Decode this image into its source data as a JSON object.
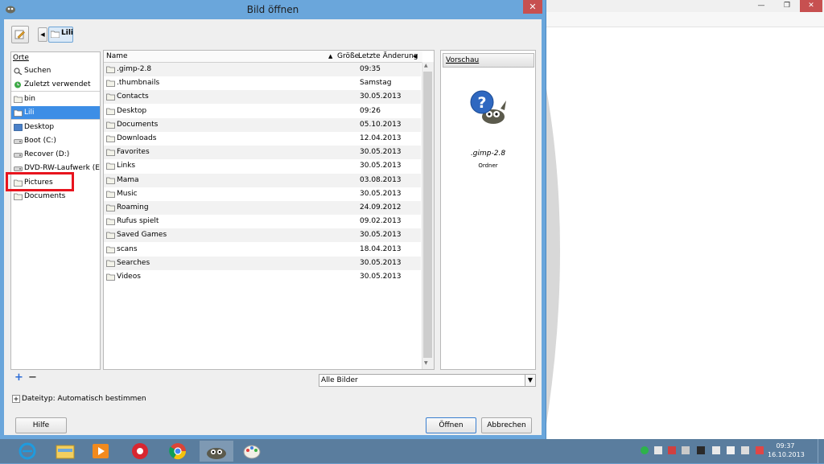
{
  "dialog": {
    "title": "Bild öffnen",
    "close_glyph": "✕"
  },
  "pathbar": {
    "current": "Lili"
  },
  "places": {
    "header": "Orte",
    "items": [
      {
        "label": "Suchen",
        "icon": "search-icon"
      },
      {
        "label": "Zuletzt verwendet",
        "icon": "recent-icon"
      },
      {
        "label": "bin",
        "icon": "folder-icon"
      },
      {
        "label": "Lili",
        "icon": "home-folder-icon",
        "selected": true
      },
      {
        "label": "Desktop",
        "icon": "desktop-icon"
      },
      {
        "label": "Boot (C:)",
        "icon": "drive-icon"
      },
      {
        "label": "Recover (D:)",
        "icon": "drive-icon"
      },
      {
        "label": "DVD-RW-Laufwerk (E:)",
        "icon": "optical-drive-icon"
      },
      {
        "label": "Pictures",
        "icon": "folder-icon"
      },
      {
        "label": "Documents",
        "icon": "folder-icon"
      }
    ]
  },
  "files": {
    "columns": {
      "name": "Name",
      "size": "Größe",
      "modified": "Letzte Änderung"
    },
    "rows": [
      {
        "name": ".gimp-2.8",
        "modified": "09:35"
      },
      {
        "name": ".thumbnails",
        "modified": "Samstag"
      },
      {
        "name": "Contacts",
        "modified": "30.05.2013"
      },
      {
        "name": "Desktop",
        "modified": "09:26"
      },
      {
        "name": "Documents",
        "modified": "05.10.2013"
      },
      {
        "name": "Downloads",
        "modified": "12.04.2013"
      },
      {
        "name": "Favorites",
        "modified": "30.05.2013"
      },
      {
        "name": "Links",
        "modified": "30.05.2013"
      },
      {
        "name": "Mama",
        "modified": "03.08.2013"
      },
      {
        "name": "Music",
        "modified": "30.05.2013"
      },
      {
        "name": "Roaming",
        "modified": "24.09.2012"
      },
      {
        "name": "Rufus spielt",
        "modified": "09.02.2013"
      },
      {
        "name": "Saved Games",
        "modified": "30.05.2013"
      },
      {
        "name": "scans",
        "modified": "18.04.2013"
      },
      {
        "name": "Searches",
        "modified": "30.05.2013"
      },
      {
        "name": "Videos",
        "modified": "30.05.2013"
      }
    ]
  },
  "preview": {
    "header": "Vorschau",
    "name": ".gimp-2.8",
    "type": "Ordner"
  },
  "filter": {
    "selected": "Alle Bilder"
  },
  "filetype": {
    "label": "Dateityp: Automatisch bestimmen"
  },
  "buttons": {
    "help": "Hilfe",
    "open": "Öffnen",
    "cancel": "Abbrechen"
  },
  "taskbar": {
    "time": "09:37",
    "date": "16.10.2013",
    "apps": [
      "internet-explorer-icon",
      "file-explorer-icon",
      "media-player-icon",
      "app-red-icon",
      "chrome-icon",
      "gimp-icon",
      "paint-icon"
    ]
  },
  "colors": {
    "selection": "#3d8ee6",
    "highlight_box": "#e8141e",
    "title_bar": "#6aa6db",
    "close_button": "#c75050"
  }
}
